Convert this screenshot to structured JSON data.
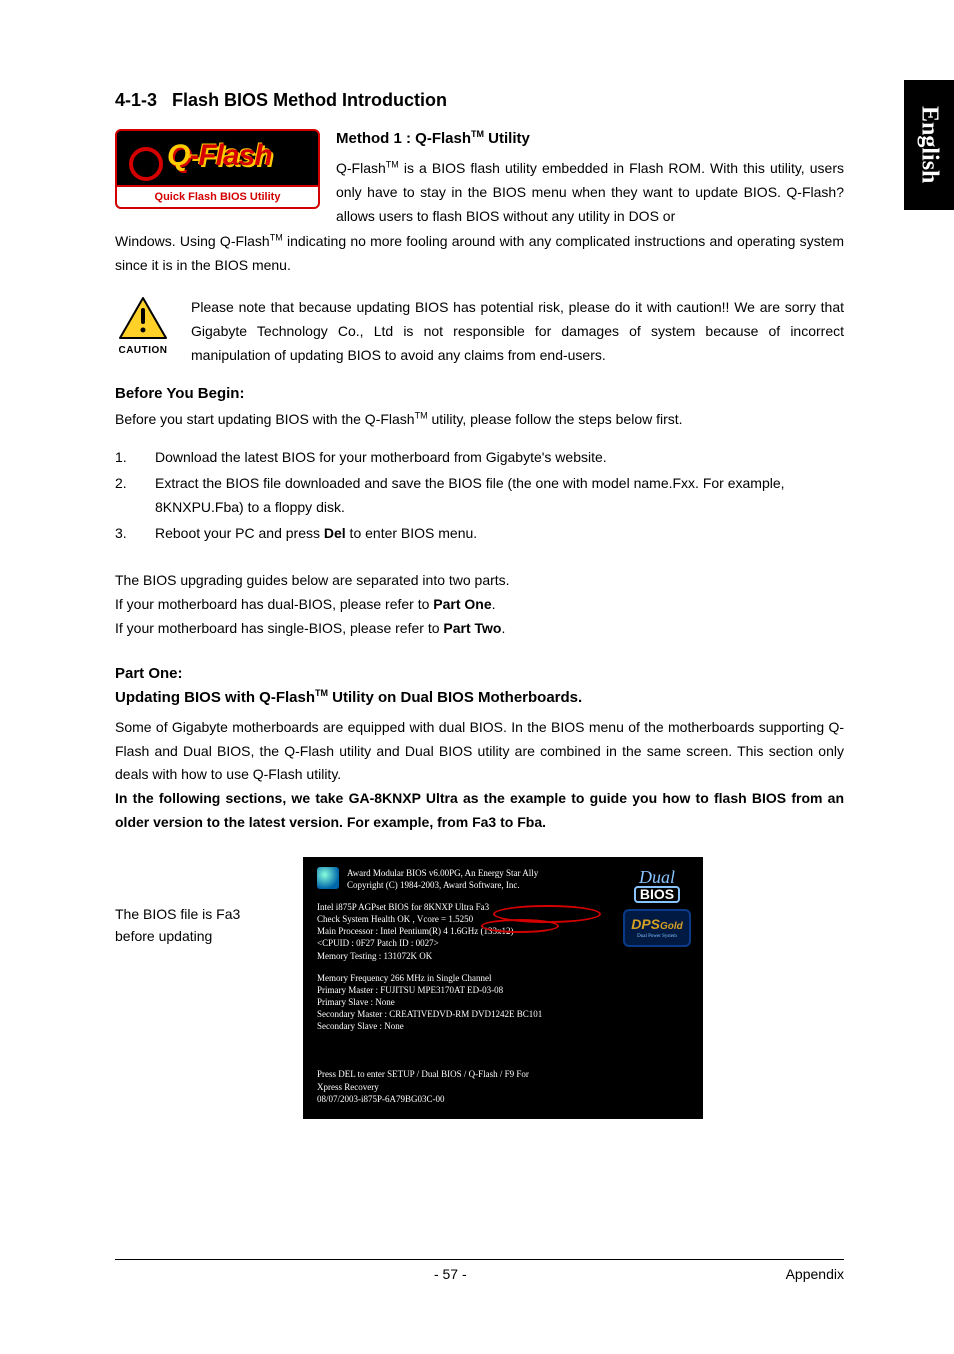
{
  "langTab": "English",
  "sectionNumber": "4-1-3",
  "sectionTitle": "Flash BIOS Method Introduction",
  "qflashLogo": {
    "main": "-Flash",
    "q": "Q",
    "band": "Quick Flash BIOS Utility"
  },
  "method1": {
    "heading_pre": "Method 1 : Q-Flash",
    "heading_post": " Utility",
    "tm": "TM",
    "p1a": "Q-Flash",
    "p1_tm": "TM",
    "p1b": " is a BIOS flash utility embedded in Flash ROM. With this utility, users only have to stay in the BIOS menu when they want to update BIOS. Q-Flash?allows users to flash BIOS without any utility in DOS or",
    "p2a": "Windows. Using Q-Flash",
    "p2_tm": "TM",
    "p2b": " indicating no more fooling around with any complicated instructions and operating system since it is in the BIOS menu."
  },
  "caution": {
    "label": "CAUTION",
    "text": "Please note that because updating BIOS has potential risk, please do it with caution!! We are sorry that Gigabyte Technology Co., Ltd is not responsible for damages of system because of incorrect manipulation of updating BIOS to avoid any claims from end-users."
  },
  "beforeBegin": {
    "heading": "Before You Begin:",
    "intro_a": "Before you start updating BIOS with the Q-Flash",
    "intro_tm": "TM",
    "intro_b": " utility, please follow the steps below first.",
    "steps": [
      "Download the latest BIOS for your motherboard from Gigabyte's website.",
      "Extract the BIOS file downloaded and save the BIOS file (the one with model name.Fxx. For example, 8KNXPU.Fba) to a floppy disk.",
      {
        "pre": "Reboot your PC and press ",
        "bold": "Del",
        "post": " to enter BIOS menu."
      }
    ]
  },
  "guidesIntro": {
    "l1": "The BIOS upgrading guides below are separated into two parts.",
    "l2a": "If your motherboard has dual-BIOS, please refer to ",
    "l2b": "Part One",
    "l2c": ".",
    "l3a": "If your motherboard has single-BIOS, please refer to ",
    "l3b": "Part Two",
    "l3c": "."
  },
  "partOne": {
    "heading": "Part One:",
    "sub_a": "Updating BIOS with Q-Flash",
    "sub_tm": "TM",
    "sub_b": " Utility on Dual BIOS Motherboards.",
    "p1": "Some of Gigabyte motherboards are equipped with dual BIOS. In the BIOS menu of the motherboards supporting Q-Flash and Dual BIOS, the Q-Flash utility and Dual BIOS utility are combined in the same screen. This section only deals with how to use Q-Flash utility.",
    "p2": "In the following sections, we take GA-8KNXP Ultra as the example to guide you how to flash BIOS from an older version to the latest version. For example, from Fa3 to Fba."
  },
  "screenshot": {
    "caption": "The BIOS file is Fa3 before updating",
    "top1": "Award Modular BIOS v6.00PG, An Energy Star Ally",
    "top2": "Copyright  (C) 1984-2003, Award Software,  Inc.",
    "l1": "Intel i875P AGPset BIOS for 8KNXP Ultra Fa3",
    "l2": "Check System Health OK , Vcore = 1.5250",
    "l3": "Main Processor : Intel Pentium(R) 4   1.6GHz (133x12)",
    "l4": "<CPUID : 0F27 Patch ID   : 0027>",
    "l5": "Memory Testing   : 131072K OK",
    "b1": "Memory Frequency 266 MHz in Single Channel",
    "b2": "Primary Master : FUJITSU MPE3170AT ED-03-08",
    "b3": "Primary Slave : None",
    "b4": "Secondary Master : CREATIVEDVD-RM DVD1242E BC101",
    "b5": "Secondary Slave : None",
    "f1": "Press DEL to enter SETUP / Dual BIOS / Q-Flash / F9 For",
    "f2": "Xpress Recovery",
    "f3": "08/07/2003-i875P-6A79BG03C-00",
    "dualLogo": {
      "top": "Dual",
      "bottom": "BIOS"
    },
    "dpsLogo": {
      "main": "DPS",
      "gold": "Gold",
      "sub": "Dual Power System"
    }
  },
  "footer": {
    "page": "- 57 -",
    "section": "Appendix"
  }
}
